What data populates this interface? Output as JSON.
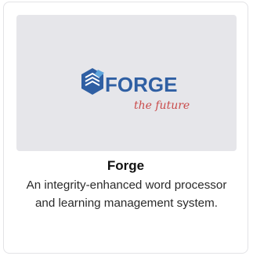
{
  "card": {
    "logo_word": "FORGE",
    "logo_tagline": "the future",
    "title": "Forge",
    "description": "An integrity-enhanced word processor and learning management system."
  },
  "colors": {
    "brand_blue": "#2f5fa3",
    "tagline_red": "#c94b4b",
    "thumb_bg": "#e6e6ea",
    "border": "#e3e3e6"
  },
  "icons": {
    "logo_mark": "hexagon-stacked-layers-icon"
  }
}
